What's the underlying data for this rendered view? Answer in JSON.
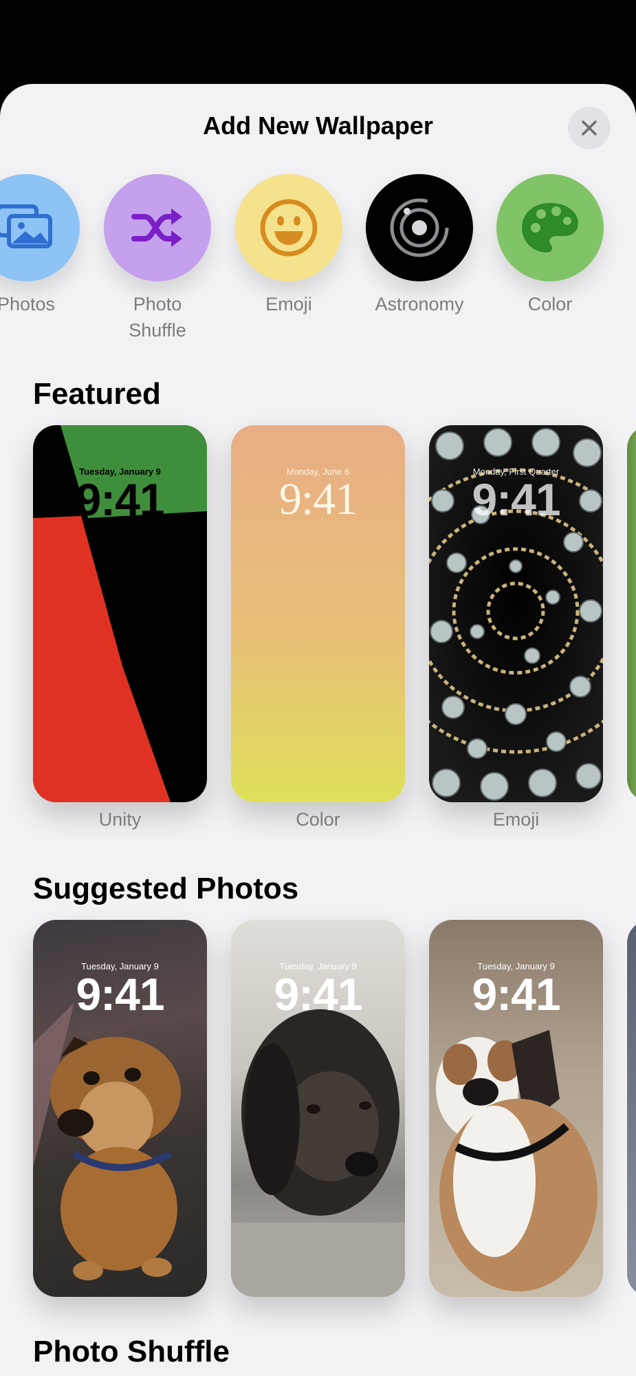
{
  "header": {
    "title": "Add New Wallpaper"
  },
  "categories": [
    {
      "label": "Photos",
      "icon": "photos-icon",
      "color": "#8ec3f5"
    },
    {
      "label": "Photo Shuffle",
      "icon": "shuffle-icon",
      "color": "#c5a0ec"
    },
    {
      "label": "Emoji",
      "icon": "smiley-icon",
      "color": "#f5e28c"
    },
    {
      "label": "Astronomy",
      "icon": "astronomy-icon",
      "color": "#000000"
    },
    {
      "label": "Color",
      "icon": "palette-icon",
      "color": "#80c467"
    }
  ],
  "featured": {
    "heading": "Featured",
    "cards": [
      {
        "caption": "Unity",
        "date": "Tuesday, January 9",
        "time": "9:41"
      },
      {
        "caption": "Color",
        "date": "Monday, June 6",
        "time": "9:41"
      },
      {
        "caption": "Emoji",
        "date": "Monday, First Quarter",
        "time": "9:41"
      }
    ]
  },
  "suggested": {
    "heading": "Suggested Photos",
    "cards": [
      {
        "date": "Tuesday, January 9",
        "time": "9:41"
      },
      {
        "date": "Tuesday, January 9",
        "time": "9:41"
      },
      {
        "date": "Tuesday, January 9",
        "time": "9:41"
      }
    ]
  },
  "photo_shuffle": {
    "heading": "Photo Shuffle"
  }
}
